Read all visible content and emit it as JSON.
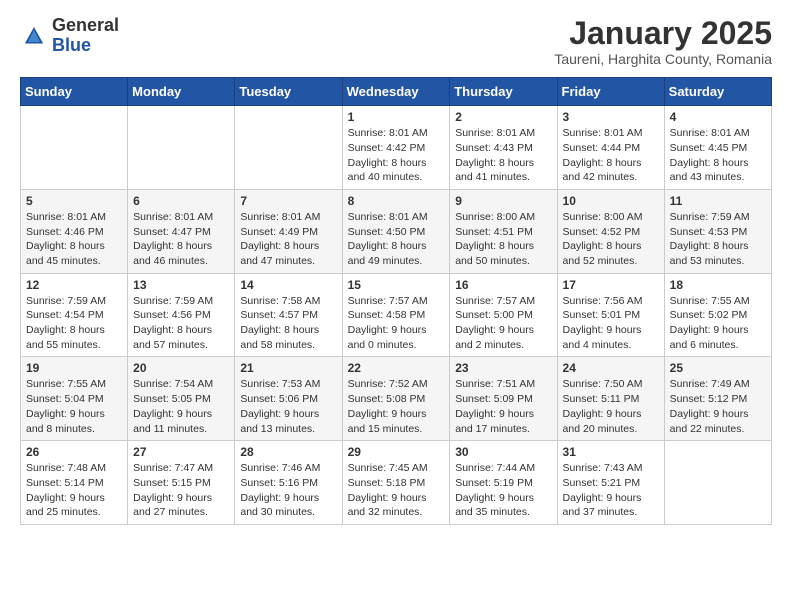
{
  "header": {
    "logo_general": "General",
    "logo_blue": "Blue",
    "month_title": "January 2025",
    "location": "Taureni, Harghita County, Romania"
  },
  "days_of_week": [
    "Sunday",
    "Monday",
    "Tuesday",
    "Wednesday",
    "Thursday",
    "Friday",
    "Saturday"
  ],
  "weeks": [
    [
      {
        "day": "",
        "info": ""
      },
      {
        "day": "",
        "info": ""
      },
      {
        "day": "",
        "info": ""
      },
      {
        "day": "1",
        "info": "Sunrise: 8:01 AM\nSunset: 4:42 PM\nDaylight: 8 hours\nand 40 minutes."
      },
      {
        "day": "2",
        "info": "Sunrise: 8:01 AM\nSunset: 4:43 PM\nDaylight: 8 hours\nand 41 minutes."
      },
      {
        "day": "3",
        "info": "Sunrise: 8:01 AM\nSunset: 4:44 PM\nDaylight: 8 hours\nand 42 minutes."
      },
      {
        "day": "4",
        "info": "Sunrise: 8:01 AM\nSunset: 4:45 PM\nDaylight: 8 hours\nand 43 minutes."
      }
    ],
    [
      {
        "day": "5",
        "info": "Sunrise: 8:01 AM\nSunset: 4:46 PM\nDaylight: 8 hours\nand 45 minutes."
      },
      {
        "day": "6",
        "info": "Sunrise: 8:01 AM\nSunset: 4:47 PM\nDaylight: 8 hours\nand 46 minutes."
      },
      {
        "day": "7",
        "info": "Sunrise: 8:01 AM\nSunset: 4:49 PM\nDaylight: 8 hours\nand 47 minutes."
      },
      {
        "day": "8",
        "info": "Sunrise: 8:01 AM\nSunset: 4:50 PM\nDaylight: 8 hours\nand 49 minutes."
      },
      {
        "day": "9",
        "info": "Sunrise: 8:00 AM\nSunset: 4:51 PM\nDaylight: 8 hours\nand 50 minutes."
      },
      {
        "day": "10",
        "info": "Sunrise: 8:00 AM\nSunset: 4:52 PM\nDaylight: 8 hours\nand 52 minutes."
      },
      {
        "day": "11",
        "info": "Sunrise: 7:59 AM\nSunset: 4:53 PM\nDaylight: 8 hours\nand 53 minutes."
      }
    ],
    [
      {
        "day": "12",
        "info": "Sunrise: 7:59 AM\nSunset: 4:54 PM\nDaylight: 8 hours\nand 55 minutes."
      },
      {
        "day": "13",
        "info": "Sunrise: 7:59 AM\nSunset: 4:56 PM\nDaylight: 8 hours\nand 57 minutes."
      },
      {
        "day": "14",
        "info": "Sunrise: 7:58 AM\nSunset: 4:57 PM\nDaylight: 8 hours\nand 58 minutes."
      },
      {
        "day": "15",
        "info": "Sunrise: 7:57 AM\nSunset: 4:58 PM\nDaylight: 9 hours\nand 0 minutes."
      },
      {
        "day": "16",
        "info": "Sunrise: 7:57 AM\nSunset: 5:00 PM\nDaylight: 9 hours\nand 2 minutes."
      },
      {
        "day": "17",
        "info": "Sunrise: 7:56 AM\nSunset: 5:01 PM\nDaylight: 9 hours\nand 4 minutes."
      },
      {
        "day": "18",
        "info": "Sunrise: 7:55 AM\nSunset: 5:02 PM\nDaylight: 9 hours\nand 6 minutes."
      }
    ],
    [
      {
        "day": "19",
        "info": "Sunrise: 7:55 AM\nSunset: 5:04 PM\nDaylight: 9 hours\nand 8 minutes."
      },
      {
        "day": "20",
        "info": "Sunrise: 7:54 AM\nSunset: 5:05 PM\nDaylight: 9 hours\nand 11 minutes."
      },
      {
        "day": "21",
        "info": "Sunrise: 7:53 AM\nSunset: 5:06 PM\nDaylight: 9 hours\nand 13 minutes."
      },
      {
        "day": "22",
        "info": "Sunrise: 7:52 AM\nSunset: 5:08 PM\nDaylight: 9 hours\nand 15 minutes."
      },
      {
        "day": "23",
        "info": "Sunrise: 7:51 AM\nSunset: 5:09 PM\nDaylight: 9 hours\nand 17 minutes."
      },
      {
        "day": "24",
        "info": "Sunrise: 7:50 AM\nSunset: 5:11 PM\nDaylight: 9 hours\nand 20 minutes."
      },
      {
        "day": "25",
        "info": "Sunrise: 7:49 AM\nSunset: 5:12 PM\nDaylight: 9 hours\nand 22 minutes."
      }
    ],
    [
      {
        "day": "26",
        "info": "Sunrise: 7:48 AM\nSunset: 5:14 PM\nDaylight: 9 hours\nand 25 minutes."
      },
      {
        "day": "27",
        "info": "Sunrise: 7:47 AM\nSunset: 5:15 PM\nDaylight: 9 hours\nand 27 minutes."
      },
      {
        "day": "28",
        "info": "Sunrise: 7:46 AM\nSunset: 5:16 PM\nDaylight: 9 hours\nand 30 minutes."
      },
      {
        "day": "29",
        "info": "Sunrise: 7:45 AM\nSunset: 5:18 PM\nDaylight: 9 hours\nand 32 minutes."
      },
      {
        "day": "30",
        "info": "Sunrise: 7:44 AM\nSunset: 5:19 PM\nDaylight: 9 hours\nand 35 minutes."
      },
      {
        "day": "31",
        "info": "Sunrise: 7:43 AM\nSunset: 5:21 PM\nDaylight: 9 hours\nand 37 minutes."
      },
      {
        "day": "",
        "info": ""
      }
    ]
  ]
}
